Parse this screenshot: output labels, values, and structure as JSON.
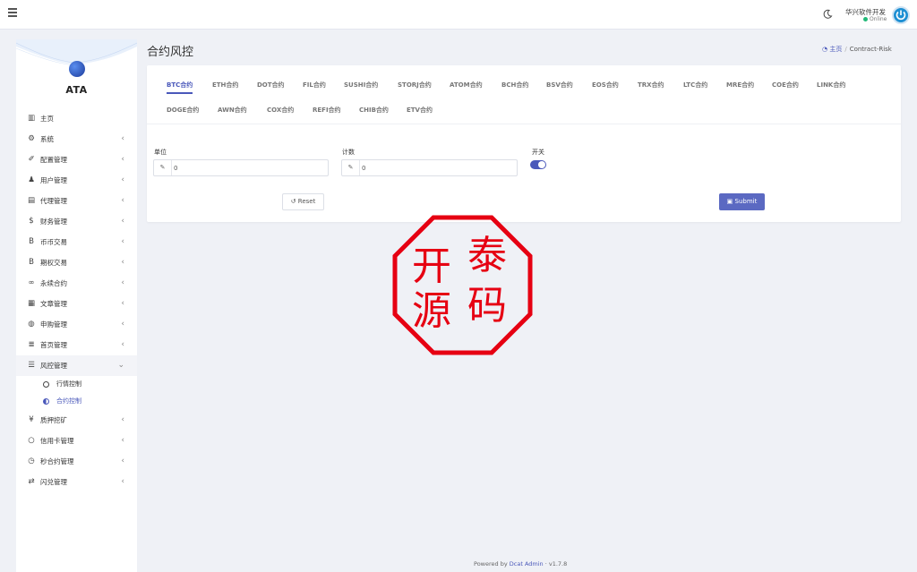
{
  "header": {
    "user_name": "华兴软件开发",
    "user_status": "Online"
  },
  "sidebar": {
    "logo_text": "ATA",
    "items": [
      {
        "label": "主页",
        "icon": "bar-chart-icon",
        "caret": ""
      },
      {
        "label": "系统",
        "icon": "gear-icon",
        "caret": "‹"
      },
      {
        "label": "配置管理",
        "icon": "wrench-icon",
        "caret": "‹"
      },
      {
        "label": "用户管理",
        "icon": "users-icon",
        "caret": "‹"
      },
      {
        "label": "代理管理",
        "icon": "id-card-icon",
        "caret": "‹"
      },
      {
        "label": "财务管理",
        "icon": "dollar-icon",
        "caret": "‹"
      },
      {
        "label": "币币交易",
        "icon": "bitcoin-icon",
        "caret": "‹"
      },
      {
        "label": "期权交易",
        "icon": "bitcoin-icon",
        "caret": "‹"
      },
      {
        "label": "永续合约",
        "icon": "link-icon",
        "caret": "‹"
      },
      {
        "label": "文章管理",
        "icon": "newspaper-icon",
        "caret": "‹"
      },
      {
        "label": "申购管理",
        "icon": "globe-icon",
        "caret": "‹"
      },
      {
        "label": "首页管理",
        "icon": "list-icon",
        "caret": "‹"
      },
      {
        "label": "风控管理",
        "icon": "server-icon",
        "caret": "⌄"
      }
    ],
    "sub_items": [
      {
        "label": "行情控制"
      },
      {
        "label": "合约控制"
      }
    ],
    "items_after": [
      {
        "label": "质押挖矿",
        "icon": "yen-icon",
        "caret": "‹"
      },
      {
        "label": "信用卡管理",
        "icon": "circle-icon",
        "caret": "‹"
      },
      {
        "label": "秒合约管理",
        "icon": "clock-icon",
        "caret": "‹"
      },
      {
        "label": "闪兑管理",
        "icon": "exchange-icon",
        "caret": "‹"
      }
    ]
  },
  "page": {
    "title": "合约风控",
    "breadcrumb_home": "主页",
    "breadcrumb_current": "Contract-Risk"
  },
  "tabs": [
    "BTC合约",
    "ETH合约",
    "DOT合约",
    "FIL合约",
    "SUSHI合约",
    "STORJ合约",
    "ATOM合约",
    "BCH合约",
    "BSV合约",
    "EOS合约",
    "TRX合约",
    "LTC合约",
    "MRE合约",
    "COE合约",
    "LINK合约",
    "DOGE合约",
    "AWN合约",
    "COX合约",
    "REFI合约",
    "CHIB合约",
    "ETV合约"
  ],
  "form": {
    "unit_label": "单位",
    "unit_value": "0",
    "count_label": "计数",
    "count_value": "0",
    "switch_label": "开关",
    "switch_on": true,
    "reset_label": "Reset",
    "submit_label": "Submit"
  },
  "stamp": {
    "chars": [
      "开",
      "泰",
      "源",
      "码"
    ]
  },
  "footer": {
    "prefix": "Powered by",
    "link": "Dcat Admin",
    "version": "v1.7.8"
  },
  "colors": {
    "accent": "#4a58ba",
    "stamp": "#e60012",
    "online": "#21b978"
  }
}
